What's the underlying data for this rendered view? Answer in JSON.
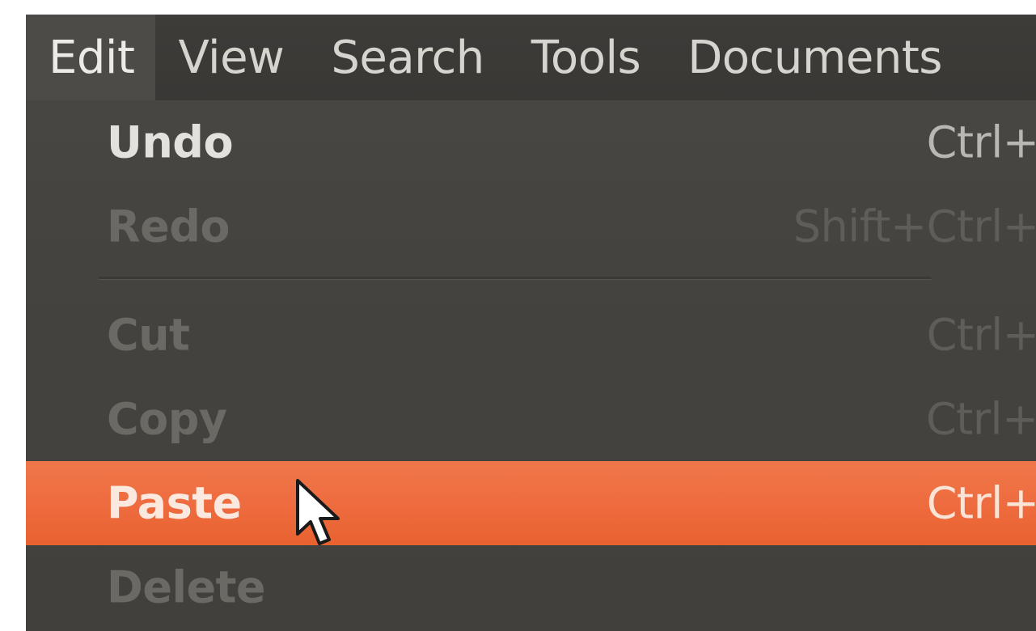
{
  "menubar": {
    "items": [
      {
        "label": "Edit",
        "active": true
      },
      {
        "label": "View",
        "active": false
      },
      {
        "label": "Search",
        "active": false
      },
      {
        "label": "Tools",
        "active": false
      },
      {
        "label": "Documents",
        "active": false
      }
    ]
  },
  "edit_menu": {
    "items": [
      {
        "label": "Undo",
        "shortcut": "Ctrl+Z",
        "state": "enabled"
      },
      {
        "label": "Redo",
        "shortcut": "Shift+Ctrl+Z",
        "state": "disabled"
      },
      {
        "label": "Cut",
        "shortcut": "Ctrl+X",
        "state": "disabled"
      },
      {
        "label": "Copy",
        "shortcut": "Ctrl+C",
        "state": "disabled"
      },
      {
        "label": "Paste",
        "shortcut": "Ctrl+V",
        "state": "highlighted"
      },
      {
        "label": "Delete",
        "shortcut": "",
        "state": "disabled"
      }
    ]
  },
  "colors": {
    "accent": "#ee6b3e",
    "menu_background": "#45433f",
    "menubar_background": "#3c3a37"
  },
  "icons": {
    "pointer": "mouse-pointer-icon"
  }
}
